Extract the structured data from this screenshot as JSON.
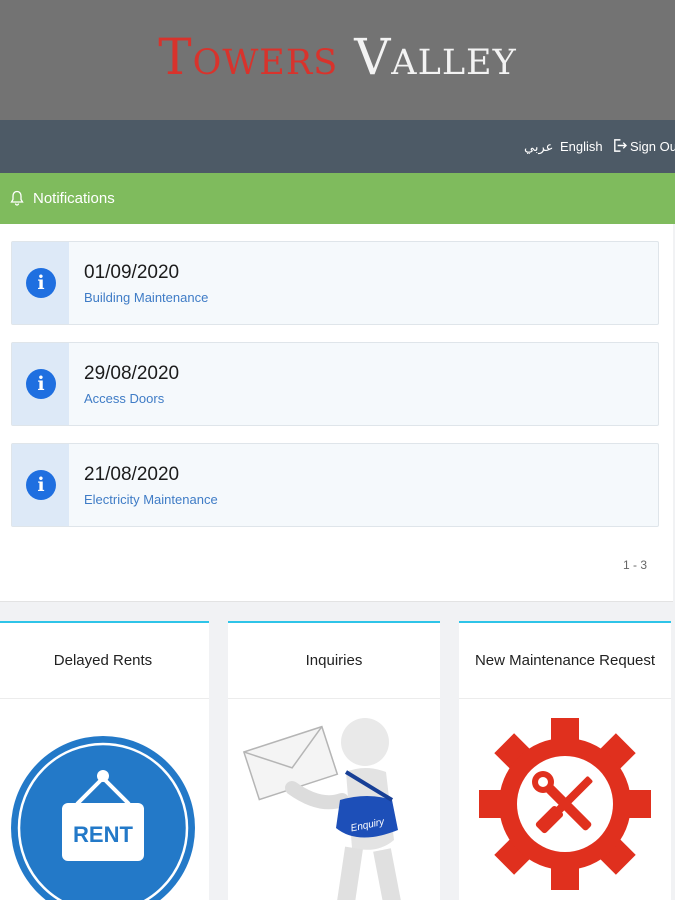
{
  "header": {
    "logo_word1": "Towers",
    "logo_word2": "Valley"
  },
  "topnav": {
    "arabic": "عربي",
    "english": "English",
    "signout": "Sign Out"
  },
  "notifications": {
    "title": "Notifications",
    "items": [
      {
        "date": "01/09/2020",
        "desc": "Building Maintenance"
      },
      {
        "date": "29/08/2020",
        "desc": "Access Doors"
      },
      {
        "date": "21/08/2020",
        "desc": "Electricity Maintenance"
      }
    ],
    "info_glyph": "i",
    "pager": "1 - 3"
  },
  "cards": [
    {
      "title": "Delayed Rents",
      "image_text": "RENT",
      "icon": "rent-sign-icon"
    },
    {
      "title": "Inquiries",
      "image_text": "Enquiry",
      "icon": "inquiry-mail-figure-icon"
    },
    {
      "title": "New Maintenance Request",
      "icon": "maintenance-gear-icon"
    }
  ],
  "colors": {
    "header": "#737373",
    "nav": "#4d5a66",
    "notif_bar": "#7fbb5d",
    "info": "#1f6fe0",
    "card_accent": "#2ec4e8",
    "rent_blue": "#2379c8",
    "gear_red": "#e0301e"
  }
}
